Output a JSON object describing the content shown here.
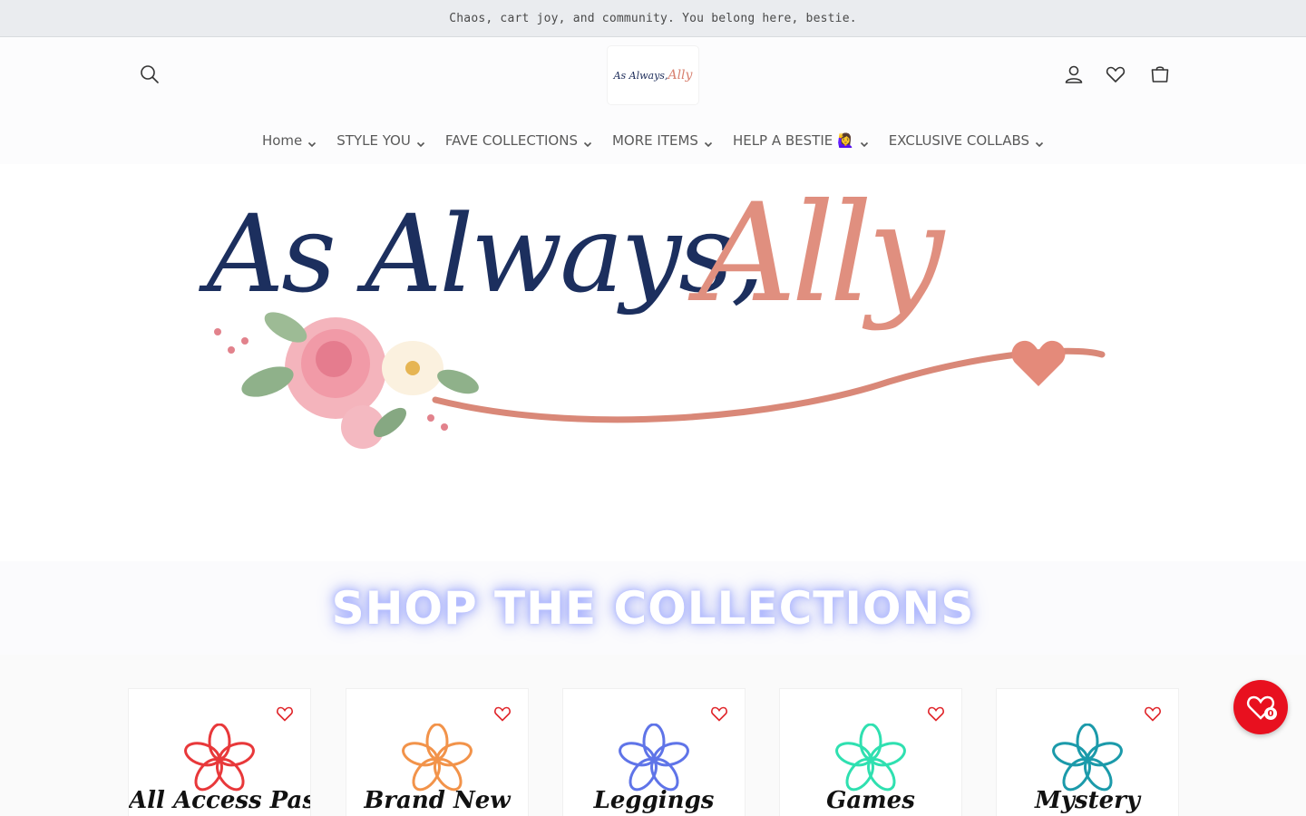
{
  "announcement": "Chaos, cart joy, and community. You belong here, bestie.",
  "header": {
    "logo_small_a": "As Always,",
    "logo_small_b": "Ally",
    "icons": [
      "search-icon",
      "account-icon",
      "wishlist-icon",
      "cart-icon"
    ]
  },
  "nav": [
    {
      "label": "Home"
    },
    {
      "label": "STYLE YOU"
    },
    {
      "label": "FAVE COLLECTIONS"
    },
    {
      "label": "MORE ITEMS"
    },
    {
      "label": "HELP A BESTIE 🙋‍♀️"
    },
    {
      "label": "EXCLUSIVE COLLABS"
    }
  ],
  "hero": {
    "line_a": "As Always,",
    "line_b": "Ally"
  },
  "shop_title": "SHOP THE COLLECTIONS",
  "collections": [
    {
      "label": "All Access Pass",
      "color": "#e8383a"
    },
    {
      "label": "Brand New",
      "color": "#f2934a"
    },
    {
      "label": "Leggings",
      "color": "#5f74e8"
    },
    {
      "label": "Games",
      "color": "#2fe0b0"
    },
    {
      "label": "Mystery",
      "color": "#1b9aaa"
    }
  ],
  "wishlist_float": {
    "count": "0"
  },
  "colors": {
    "accent_red": "#e8101f",
    "navy": "#1c2f5e",
    "rose_gold": "#e08f7f"
  }
}
